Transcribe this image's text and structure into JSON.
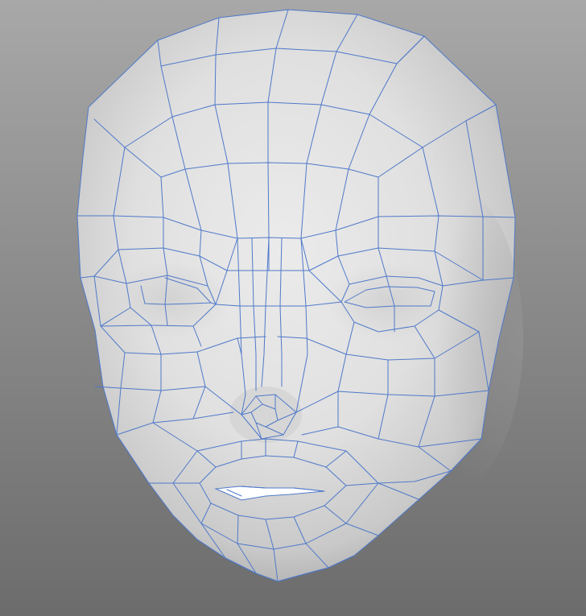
{
  "scene": {
    "subject": "face-mesh",
    "background_top": "#a8a8a8",
    "background_bottom": "#6c6c6c",
    "surface_color": "#e2e2e2",
    "wire_color": "#4f79c9"
  }
}
